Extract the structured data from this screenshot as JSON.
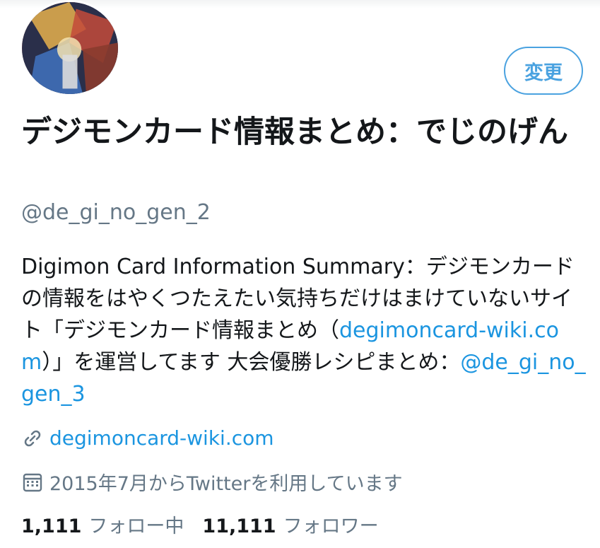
{
  "profile": {
    "display_name": "デジモンカード情報まとめ：でじのげん",
    "handle": "@de_gi_no_gen_2",
    "edit_button_label": "変更",
    "bio_part1": "Digimon Card Information Summary：デジモンカードの情報をはやくつたえたい気持ちだけはまけていないサイト「デジモンカード情報まとめ（",
    "bio_link1": "degimoncard-wiki.com",
    "bio_part2": "）」を運営してます 大会優勝レシピまとめ：",
    "bio_link2": "@de_gi_no_gen_3",
    "website": "degimoncard-wiki.com",
    "joined": "2015年7月からTwitterを利用しています",
    "following_count": "1,111",
    "following_label": "フォロー中",
    "followers_count": "11,111",
    "followers_label": "フォロワー"
  },
  "icons": {
    "website": "link-icon",
    "joined": "calendar-icon"
  },
  "colors": {
    "accent": "#1b95e0",
    "secondary_text": "#657786",
    "primary_text": "#14171a"
  }
}
